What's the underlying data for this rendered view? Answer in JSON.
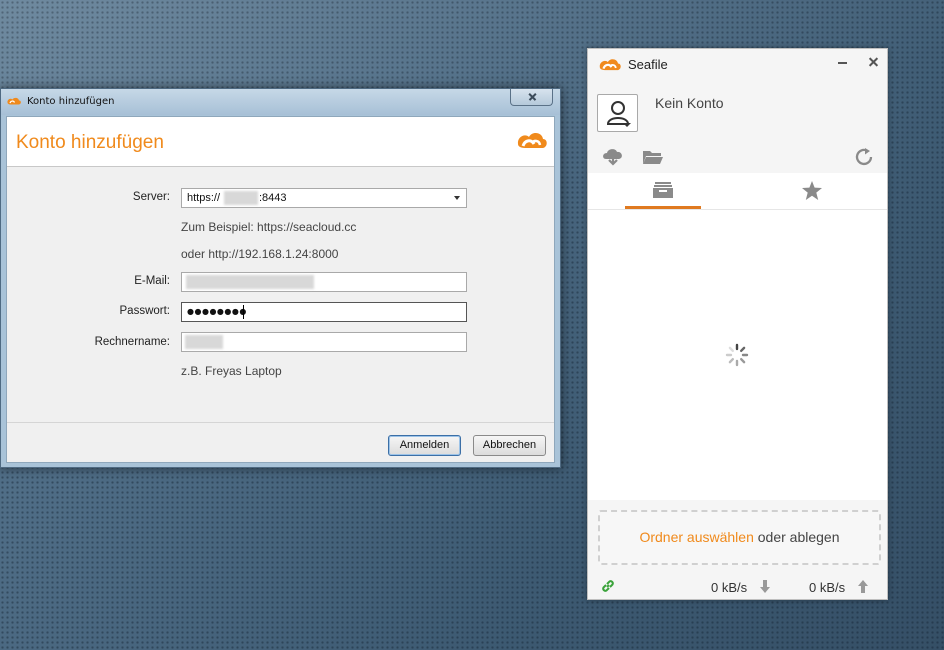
{
  "dialog": {
    "title": "Konto hinzufügen",
    "heading": "Konto hinzufügen",
    "labels": {
      "server": "Server:",
      "email": "E-Mail:",
      "password": "Passwort:",
      "computer_name": "Rechnername:"
    },
    "server": {
      "prefix": "https://",
      "suffix": ":8443"
    },
    "server_hint_1": "Zum Beispiel: https://seacloud.cc",
    "server_hint_2": "oder http://192.168.1.24:8000",
    "password_mask": "●●●●●●●●",
    "computer_name_hint": "z.B. Freyas Laptop",
    "buttons": {
      "login": "Anmelden",
      "cancel": "Abbrechen"
    }
  },
  "seafile": {
    "title": "Seafile",
    "account": "Kein Konto",
    "drop_area": {
      "link": "Ordner auswählen",
      "rest": " oder ablegen"
    },
    "download_rate": "0 kB/s",
    "upload_rate": "0 kB/s"
  },
  "colors": {
    "accent": "#f08a1c",
    "tab_indicator": "#e07a20",
    "link_ok": "#3aa33a"
  },
  "icons": {
    "logo": "seafile-logo-icon",
    "close": "close-icon",
    "minimize": "minimize-icon",
    "avatar": "user-icon",
    "cloud_download": "cloud-download-icon",
    "folder": "folder-icon",
    "refresh": "refresh-icon",
    "libraries_tab": "inbox-icon",
    "starred_tab": "star-icon",
    "spinner": "loading-spinner-icon",
    "link": "link-icon",
    "arrow_down": "arrow-down-icon",
    "arrow_up": "arrow-up-icon"
  }
}
